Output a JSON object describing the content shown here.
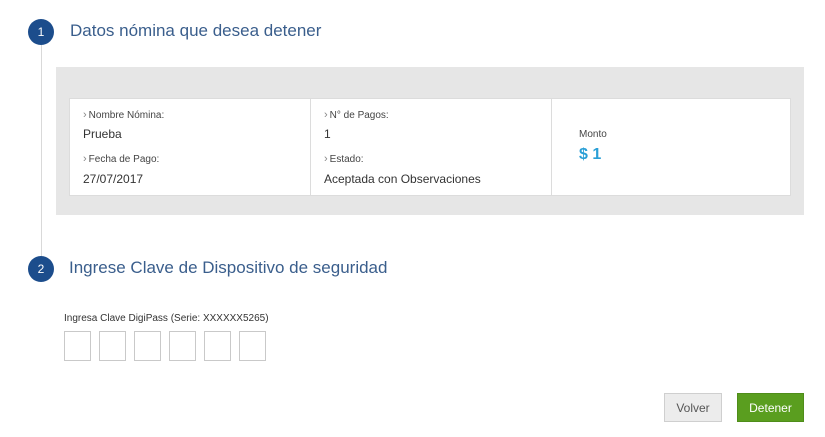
{
  "step1": {
    "number": "1",
    "title": "Datos nómina que desea detener"
  },
  "summary": {
    "nombre_label": "Nombre Nómina:",
    "nombre_value": "Prueba",
    "fecha_label": "Fecha de Pago:",
    "fecha_value": "27/07/2017",
    "pagos_label": "N° de Pagos:",
    "pagos_value": "1",
    "estado_label": "Estado:",
    "estado_value": "Aceptada con Observaciones",
    "monto_label": "Monto",
    "monto_value": "$ 1"
  },
  "step2": {
    "number": "2",
    "title": "Ingrese Clave de Dispositivo de seguridad",
    "digipass_label": "Ingresa Clave DigiPass (Serie: XXXXXX5265)"
  },
  "actions": {
    "volver_label": "Volver",
    "detener_label": "Detener"
  },
  "colors": {
    "step_badge": "#1c4d8c",
    "step_title": "#3a5e8c",
    "monto_accent": "#2a9fd6",
    "detener_button": "#5a9e1f",
    "panel_background": "#e6e6e6"
  },
  "icons": {
    "field_prefix": "chevron-right-icon"
  }
}
